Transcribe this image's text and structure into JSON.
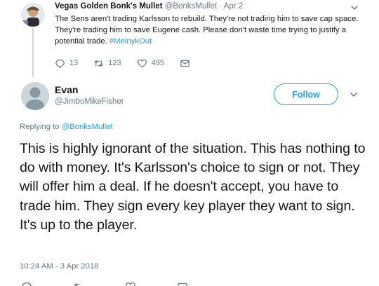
{
  "parent_tweet": {
    "display_name": "Vegas Golden Bonk's Mullet",
    "handle": "@BonksMullet",
    "separator": "·",
    "date": "Apr 2",
    "text": "The Sens aren't trading Karlsson to rebuild. They're not trading him to save cap space. They're trading him to save Eugene cash. Please don't waste time trying to justify a potential trade.",
    "hashtag": "#MelnykOut",
    "reply_count": "13",
    "retweet_count": "123",
    "like_count": "495"
  },
  "main_tweet": {
    "display_name": "Evan",
    "handle": "@JimboMikeFisher",
    "follow_label": "Follow",
    "replying_prefix": "Replying to",
    "replying_to": "@BonksMullet",
    "text": "This is highly ignorant of the situation. This has nothing to do with money. It's Karlsson's choice to sign or not. They will offer him a deal. If he doesn't accept, you have to trade him. They sign every key player they want to sign. It's up to the player.",
    "timestamp": "10:24 AM - 3 Apr 2018"
  },
  "icons": {
    "reply": "reply-icon",
    "retweet": "retweet-icon",
    "like": "heart-icon",
    "message": "envelope-icon",
    "more": "chevron-down-icon"
  },
  "colors": {
    "accent": "#1da1f2",
    "secondary_text": "#657786",
    "primary_text": "#14171a",
    "thread_line": "#ccd6dd"
  }
}
